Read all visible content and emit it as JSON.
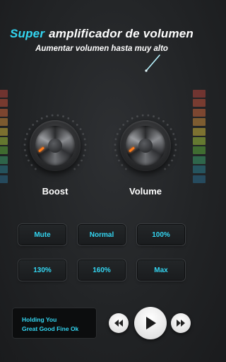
{
  "header": {
    "title_accent": "Super",
    "title_rest": "amplificador de volumen",
    "subtitle": "Aumentar volumen hasta muy alto"
  },
  "knobs": {
    "boost_label": "Boost",
    "volume_label": "Volume"
  },
  "presets": [
    "Mute",
    "Normal",
    "100%",
    "130%",
    "160%",
    "Max"
  ],
  "player": {
    "track_line1": "Holding You",
    "track_line2": "Great Good Fine Ok"
  },
  "colors": {
    "accent": "#33d6f2",
    "indicator": "#ff7a1a",
    "meter": [
      "#b0433a",
      "#c0503a",
      "#c8653a",
      "#c88a3a",
      "#c8b23a",
      "#9cbf3a",
      "#5aa83a",
      "#3a9c6a",
      "#2a7c8c",
      "#2a6c8c"
    ]
  },
  "icons": {
    "prev": "skip-previous-icon",
    "play": "play-icon",
    "next": "skip-next-icon"
  }
}
